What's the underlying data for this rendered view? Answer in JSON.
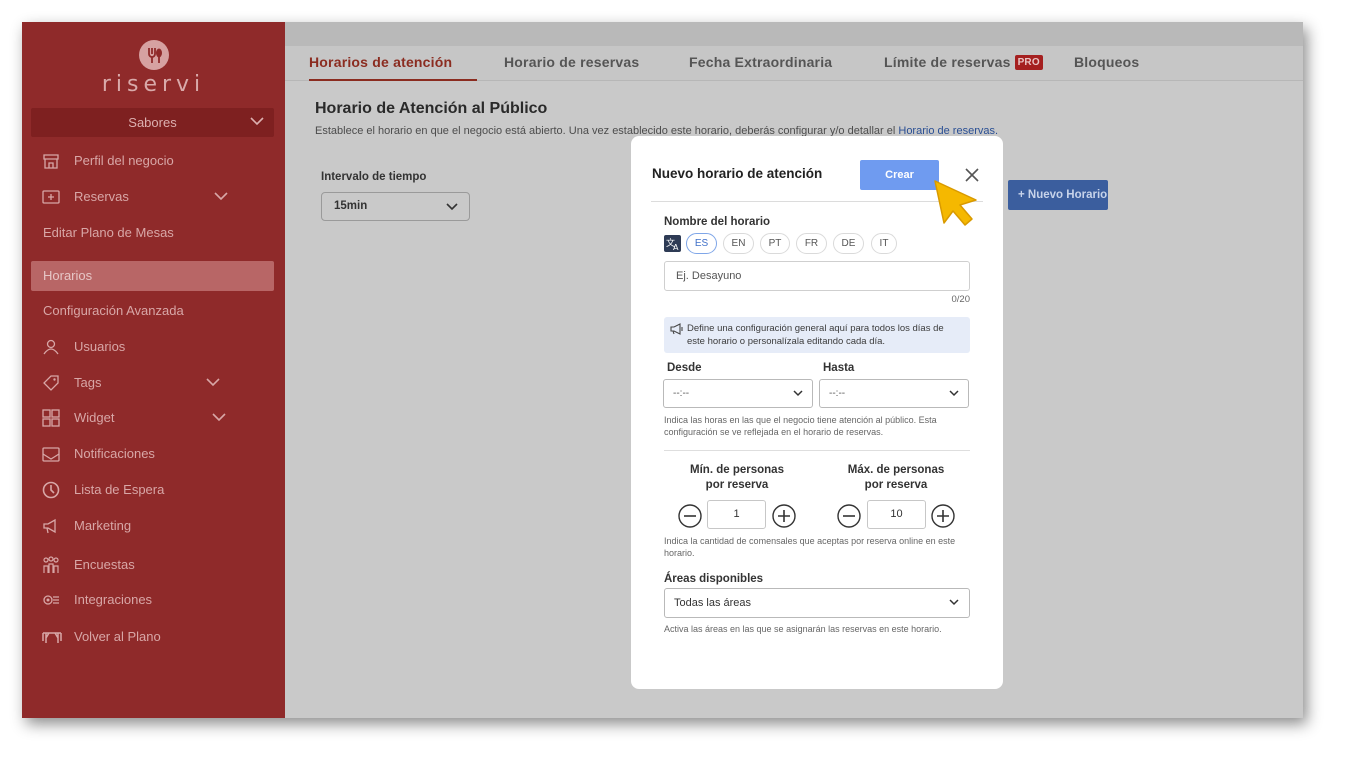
{
  "brand": {
    "name": "riservi"
  },
  "sidebar": {
    "store_selector": "Sabores",
    "items": [
      {
        "label": "Perfil del negocio",
        "icon": "store-icon"
      },
      {
        "label": "Reservas",
        "icon": "calendar-icon",
        "expandable": true
      },
      {
        "label": "Editar Plano de Mesas"
      },
      {
        "label": "Horarios",
        "active": true
      },
      {
        "label": "Configuración Avanzada"
      },
      {
        "label": "Usuarios",
        "icon": "user-icon"
      },
      {
        "label": "Tags",
        "icon": "tag-icon",
        "expandable": true
      },
      {
        "label": "Widget",
        "icon": "widget-icon",
        "expandable": true
      },
      {
        "label": "Notificaciones",
        "icon": "mail-icon"
      },
      {
        "label": "Lista de Espera",
        "icon": "clock-icon"
      },
      {
        "label": "Marketing",
        "icon": "megaphone-icon"
      },
      {
        "label": "Encuestas",
        "icon": "survey-icon"
      },
      {
        "label": "Integraciones",
        "icon": "integrations-icon"
      },
      {
        "label": "Volver al Plano",
        "icon": "table-icon"
      }
    ]
  },
  "tabs": [
    {
      "label": "Horarios de atención",
      "active": true
    },
    {
      "label": "Horario de reservas"
    },
    {
      "label": "Fecha Extraordinaria"
    },
    {
      "label": "Límite de reservas",
      "badge": "PRO"
    },
    {
      "label": "Bloqueos"
    }
  ],
  "page": {
    "title": "Horario de Atención al Público",
    "subtitle": "Establece el horario en que el negocio está abierto. Una vez establecido este horario, deberás configurar y/o detallar el",
    "subtitle_link": "Horario de reservas.",
    "interval_label": "Intervalo de tiempo",
    "interval_value": "15min",
    "new_button": "Nuevo Horario"
  },
  "modal": {
    "title": "Nuevo horario de atención",
    "create_button": "Crear",
    "name_label": "Nombre del horario",
    "languages": [
      "ES",
      "EN",
      "PT",
      "FR",
      "DE",
      "IT"
    ],
    "active_language": "ES",
    "name_placeholder": "Ej. Desayuno",
    "name_counter": "0/20",
    "info_text": "Define una configuración general aquí para todos los días de este horario o personalízala editando cada día.",
    "from_label": "Desde",
    "from_value": "--:--",
    "to_label": "Hasta",
    "to_value": "--:--",
    "hours_hint": "Indica las horas en las que el negocio tiene atención al público. Esta configuración se ve reflejada en el horario de reservas.",
    "min_label_line1": "Mín. de personas",
    "min_label_line2": "por reserva",
    "min_value": "1",
    "max_label_line1": "Máx. de personas",
    "max_label_line2": "por reserva",
    "max_value": "10",
    "people_hint": "Indica la cantidad de comensales que aceptas por reserva online en este horario.",
    "areas_label": "Áreas disponibles",
    "areas_value": "Todas las áreas",
    "areas_hint": "Activa las áreas en las que se asignarán las reservas en este horario."
  },
  "colors": {
    "sidebar": "#8f2a2a",
    "accent": "#6f9bf0",
    "active_tab": "#8b2c20",
    "cursor": "#f5b800"
  }
}
